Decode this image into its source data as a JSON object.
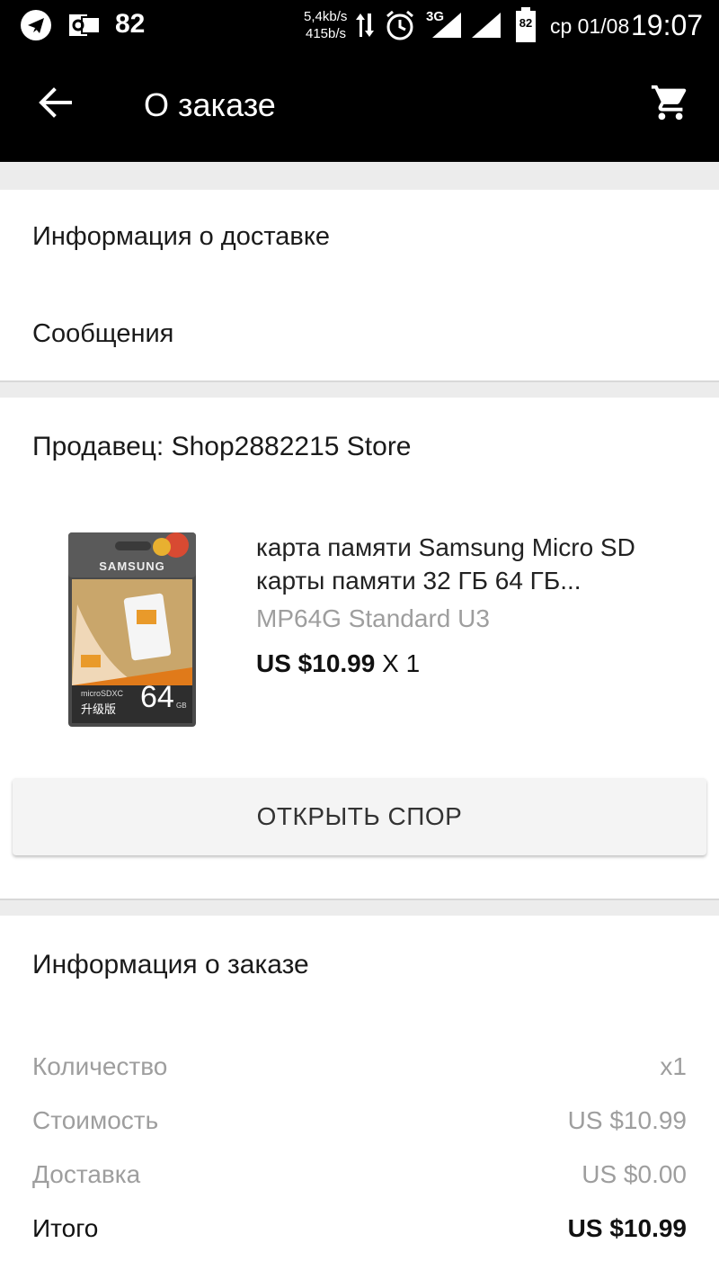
{
  "status_bar": {
    "notif_count": "82",
    "net_down": "5,4kb/s",
    "net_up": "415b/s",
    "network_type": "3G",
    "battery": "82",
    "date": "ср 01/08",
    "time": "19:07",
    "icons": [
      "telegram-icon",
      "outlook-icon",
      "data-arrows-icon",
      "alarm-icon",
      "signal-icon",
      "signal-icon",
      "battery-icon"
    ]
  },
  "toolbar": {
    "title": "О заказе",
    "icons": [
      "back-arrow-icon",
      "cart-icon"
    ]
  },
  "menu": {
    "delivery_info": "Информация о доставке",
    "messages": "Сообщения"
  },
  "seller": {
    "label": "Продавец: Shop2882215 Store"
  },
  "product": {
    "title": "карта памяти Samsung Micro SD карты памяти 32 ГБ 64 ГБ...",
    "variant": "MP64G Standard U3",
    "price": "US $10.99",
    "quantity": "X 1",
    "image": {
      "brand": "SAMSUNG",
      "capacity": "64",
      "capacity_unit": "GB",
      "card_type": "microSDXC",
      "edition": "升级版"
    }
  },
  "dispute_button": "ОТКРЫТЬ СПОР",
  "order_info": {
    "heading": "Информация о заказе",
    "rows": [
      {
        "label": "Количество",
        "value": "x1"
      },
      {
        "label": "Стоимость",
        "value": "US $10.99"
      },
      {
        "label": "Доставка",
        "value": "US $0.00"
      },
      {
        "label": "Итого",
        "value": "US $10.99"
      }
    ]
  },
  "colors": {
    "toolbar_bg": "#000000",
    "page_bg": "#ececec",
    "card_bg": "#ffffff",
    "muted_text": "#9e9e9e"
  }
}
